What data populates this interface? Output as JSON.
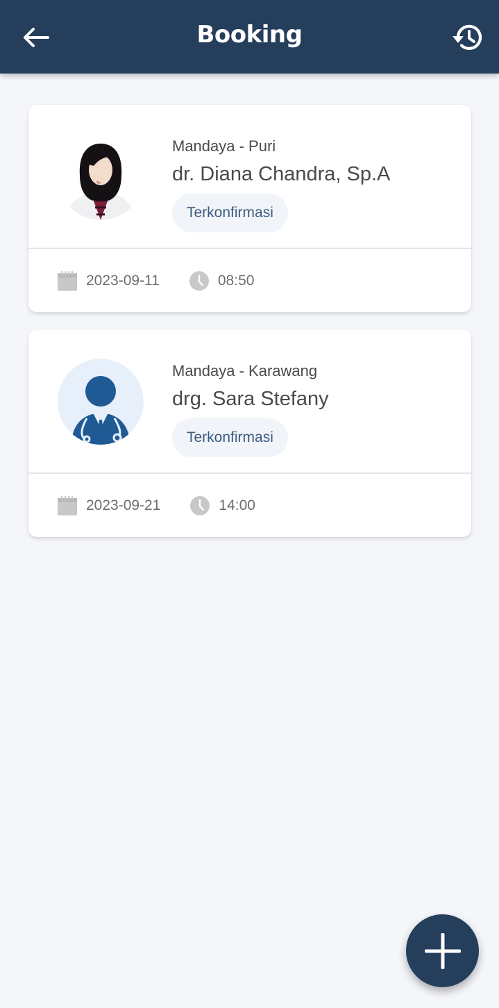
{
  "header": {
    "title": "Booking",
    "back_icon": "arrow-left-icon",
    "history_icon": "history-icon",
    "background": "#253e5c"
  },
  "bookings": [
    {
      "hospital": "Mandaya - Puri",
      "doctor": "dr. Diana Chandra, Sp.A",
      "status": "Terkonfirmasi",
      "date": "2023-09-11",
      "time": "08:50",
      "avatar": "doctor-photo"
    },
    {
      "hospital": "Mandaya - Karawang",
      "doctor": "drg. Sara Stefany",
      "status": "Terkonfirmasi",
      "date": "2023-09-21",
      "time": "14:00",
      "avatar": "doctor-placeholder-icon"
    }
  ],
  "fab": {
    "icon": "plus-icon"
  },
  "colors": {
    "primary": "#253e5c",
    "badge_bg": "#f1f4f9",
    "badge_text": "#3c5a80",
    "page_bg": "#f4f6fa"
  }
}
